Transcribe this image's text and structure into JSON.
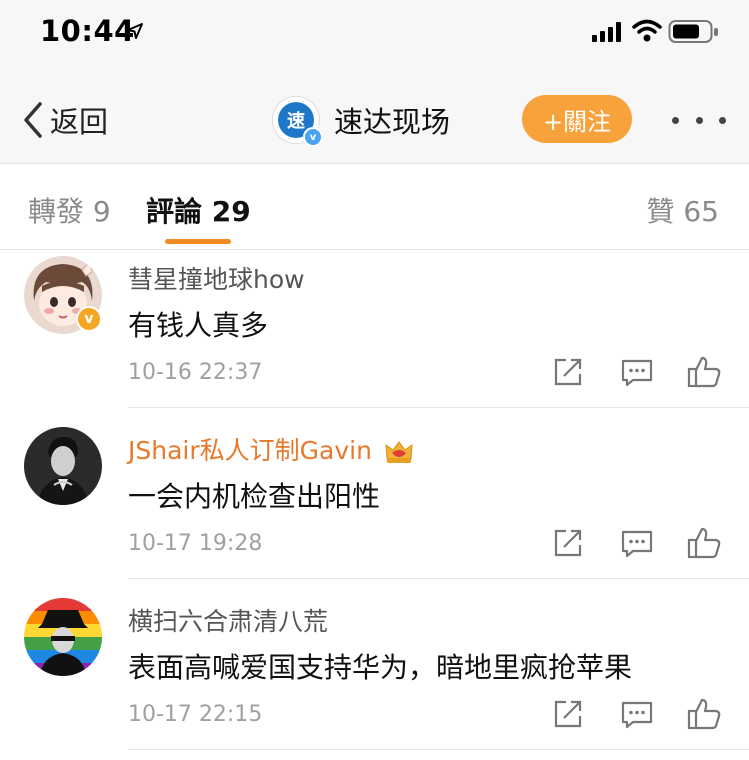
{
  "status_bar": {
    "time": "10:44"
  },
  "nav": {
    "back_label": "返回",
    "avatar_glyph": "速",
    "avatar_verify": "v",
    "title": "速达现场",
    "follow_label": "+關注"
  },
  "tabs": {
    "repost_label": "轉發 9",
    "comments_label": "評論 29",
    "likes_label": "贊 65"
  },
  "comments": [
    {
      "username": "彗星撞地球how",
      "text": "有钱人真多",
      "timestamp": "10-16 22:37",
      "verified_badge": "v"
    },
    {
      "username": "JShair私人订制Gavin",
      "text": "一会内机检查出阳性",
      "timestamp": "10-17 19:28"
    },
    {
      "username": "横扫六合肃清八荒",
      "text": "表面高喊爱国支持华为，暗地里疯抢苹果",
      "timestamp": "10-17 22:15"
    }
  ],
  "colors": {
    "accent_orange": "#f7a23b",
    "tab_underline": "#f08a24",
    "vip_name": "#e8792c",
    "verify_blue": "#4aa3f3",
    "verify_gold": "#f5a623"
  },
  "icons": {
    "share": "share-icon",
    "reply": "comment-icon",
    "like": "thumbs-up-icon",
    "back": "chevron-left-icon",
    "more": "more-dots-icon"
  }
}
